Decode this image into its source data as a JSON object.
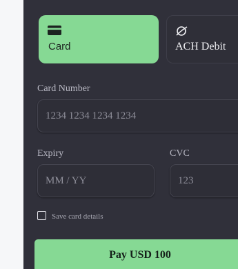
{
  "payment_methods": {
    "tabs": [
      {
        "label": "Card",
        "icon": "credit-card-icon",
        "selected": true
      },
      {
        "label": "ACH Debit",
        "icon": "bank-icon",
        "selected": false
      }
    ]
  },
  "form": {
    "card_number_label": "Card Number",
    "card_number_placeholder": "1234 1234 1234 1234",
    "expiry_label": "Expiry",
    "expiry_placeholder": "MM / YY",
    "cvc_label": "CVC",
    "cvc_placeholder": "123",
    "save_card_label": "Save card details",
    "save_card_checked": false
  },
  "pay_button_label": "Pay USD 100",
  "colors": {
    "accent": "#86d994",
    "panel": "#30303a",
    "page": "#f6f7f9"
  }
}
